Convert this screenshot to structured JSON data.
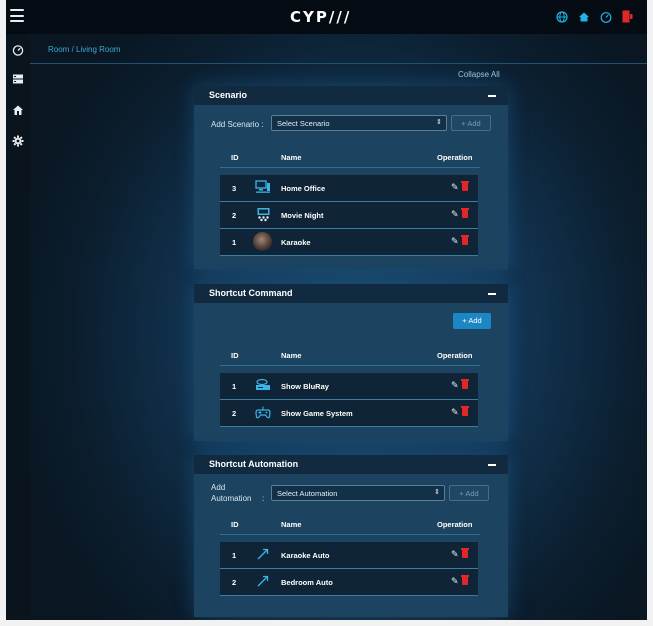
{
  "header": {
    "logo": "CYP///",
    "icons": [
      "globe-icon",
      "home-icon",
      "dashboard-icon",
      "exit-icon"
    ]
  },
  "sidebar": {
    "icons": [
      "dashboard-icon",
      "devices-icon",
      "room-icon",
      "settings-icon"
    ]
  },
  "breadcrumb": "Room / Living Room",
  "collapse_all": "Collapse All",
  "scenario": {
    "title": "Scenario",
    "add_label": "Add Scenario :",
    "select_value": "Select Scenario",
    "add_button": "+ Add",
    "columns": [
      "ID",
      "Name",
      "Operation"
    ],
    "rows": [
      {
        "id": "3",
        "name": "Home Office",
        "icon": "home-office-icon"
      },
      {
        "id": "2",
        "name": "Movie Night",
        "icon": "movie-night-icon"
      },
      {
        "id": "1",
        "name": "Karaoke",
        "icon": "karaoke-photo"
      }
    ]
  },
  "shortcut_command": {
    "title": "Shortcut Command",
    "add_button": "+ Add",
    "columns": [
      "ID",
      "Name",
      "Operation"
    ],
    "rows": [
      {
        "id": "1",
        "name": "Show BluRay",
        "icon": "bluray-player-icon"
      },
      {
        "id": "2",
        "name": "Show Game System",
        "icon": "gamepad-icon"
      }
    ]
  },
  "shortcut_automation": {
    "title": "Shortcut Automation",
    "add_label_1": "Add",
    "add_label_2": "Automation",
    "add_label_colon": ":",
    "select_value": "Select Automation",
    "add_button": "+ Add",
    "columns": [
      "ID",
      "Name",
      "Operation"
    ],
    "rows": [
      {
        "id": "1",
        "name": "Karaoke Auto",
        "icon": "automation-arrow-icon"
      },
      {
        "id": "2",
        "name": "Bedroom Auto",
        "icon": "automation-arrow-icon"
      }
    ]
  },
  "colors": {
    "accent": "#1d86c5",
    "delete": "#e02828",
    "panel": "#1c4360",
    "panel_header": "#112a40"
  }
}
